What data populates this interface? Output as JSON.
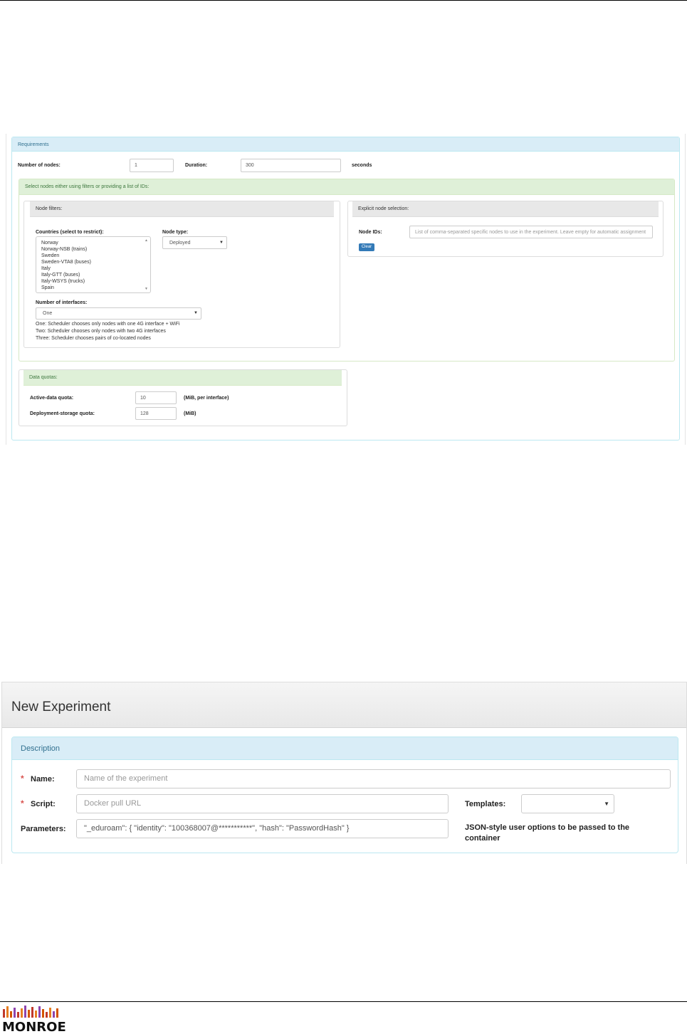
{
  "requirements": {
    "heading": "Requirements",
    "nodes_label": "Number of nodes:",
    "nodes_value": "1",
    "duration_label": "Duration:",
    "duration_value": "300",
    "duration_unit": "seconds",
    "select_heading": "Select nodes either using filters or providing a list of IDs:",
    "filters": {
      "heading": "Node filters:",
      "countries_label": "Countries (select to restrict):",
      "countries": [
        "Norway",
        "Norway-NSB (trains)",
        "Sweden",
        "Sweden-VTA8 (buses)",
        "Italy",
        "Italy-GTT (buses)",
        "Italy-WSYS (trucks)",
        "Spain"
      ],
      "node_type_label": "Node type:",
      "node_type_value": "Deployed",
      "interfaces_label": "Number of interfaces:",
      "interfaces_value": "One",
      "interfaces_help": [
        "One: Scheduler chooses only nodes with one 4G interface + WiFi",
        "Two: Scheduler chooses only nodes with two 4G interfaces",
        "Three: Scheduler chooses pairs of co-located nodes"
      ]
    },
    "explicit": {
      "heading": "Explicit node selection:",
      "ids_label": "Node IDs:",
      "ids_placeholder": "List of comma-separated specific nodes to use in the experiment. Leave empty for automatic assignment",
      "clear_label": "Clear"
    },
    "quotas": {
      "heading": "Data quotas:",
      "active_label": "Active-data quota:",
      "active_value": "10",
      "active_unit": "(MiB, per interface)",
      "storage_label": "Deployment-storage quota:",
      "storage_value": "128",
      "storage_unit": "(MiB)"
    }
  },
  "experiment": {
    "title": "New Experiment",
    "description_heading": "Description",
    "name_label": "Name:",
    "name_placeholder": "Name of the experiment",
    "script_label": "Script:",
    "script_placeholder": "Docker pull URL",
    "templates_label": "Templates:",
    "templates_value": "",
    "parameters_label": "Parameters:",
    "parameters_value": "\"_eduroam\": { \"identity\": \"100368007@***********\",  \"hash\": \"PasswordHash\" }",
    "parameters_hint": "JSON-style user options to be passed to the container",
    "required_mark": "*"
  },
  "logo": {
    "text": "MONROE",
    "colors": [
      "#c0392b",
      "#e67e22",
      "#8e44ad",
      "#d35400"
    ]
  }
}
